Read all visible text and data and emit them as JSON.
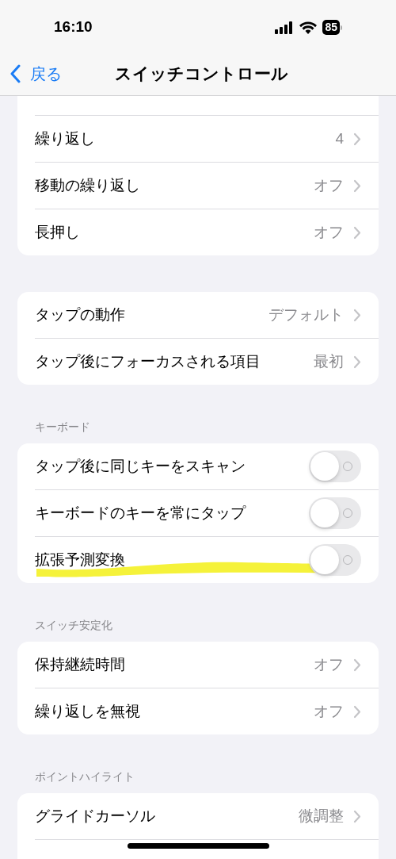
{
  "status_bar": {
    "time": "16:10",
    "battery": "85"
  },
  "nav": {
    "back": "戻る",
    "title": "スイッチコントロール"
  },
  "sections": [
    {
      "rows": [
        {
          "kind": "link",
          "label": "繰り返し",
          "value": "4"
        },
        {
          "kind": "link",
          "label": "移動の繰り返し",
          "value": "オフ"
        },
        {
          "kind": "link",
          "label": "長押し",
          "value": "オフ"
        }
      ],
      "cut_top": true
    },
    {
      "rows": [
        {
          "kind": "link",
          "label": "タップの動作",
          "value": "デフォルト"
        },
        {
          "kind": "link",
          "label": "タップ後にフォーカスされる項目",
          "value": "最初"
        }
      ]
    },
    {
      "header": "キーボード",
      "rows": [
        {
          "kind": "toggle",
          "label": "タップ後に同じキーをスキャン",
          "on": false
        },
        {
          "kind": "toggle",
          "label": "キーボードのキーを常にタップ",
          "on": false
        },
        {
          "kind": "toggle",
          "label": "拡張予測変換",
          "on": false,
          "highlighted": true
        }
      ]
    },
    {
      "header": "スイッチ安定化",
      "rows": [
        {
          "kind": "link",
          "label": "保持継続時間",
          "value": "オフ"
        },
        {
          "kind": "link",
          "label": "繰り返しを無視",
          "value": "オフ"
        }
      ]
    },
    {
      "header": "ポイントハイライト",
      "rows": [
        {
          "kind": "link",
          "label": "グライドカーソル",
          "value": "微調整"
        }
      ],
      "cut_bottom": true
    }
  ]
}
